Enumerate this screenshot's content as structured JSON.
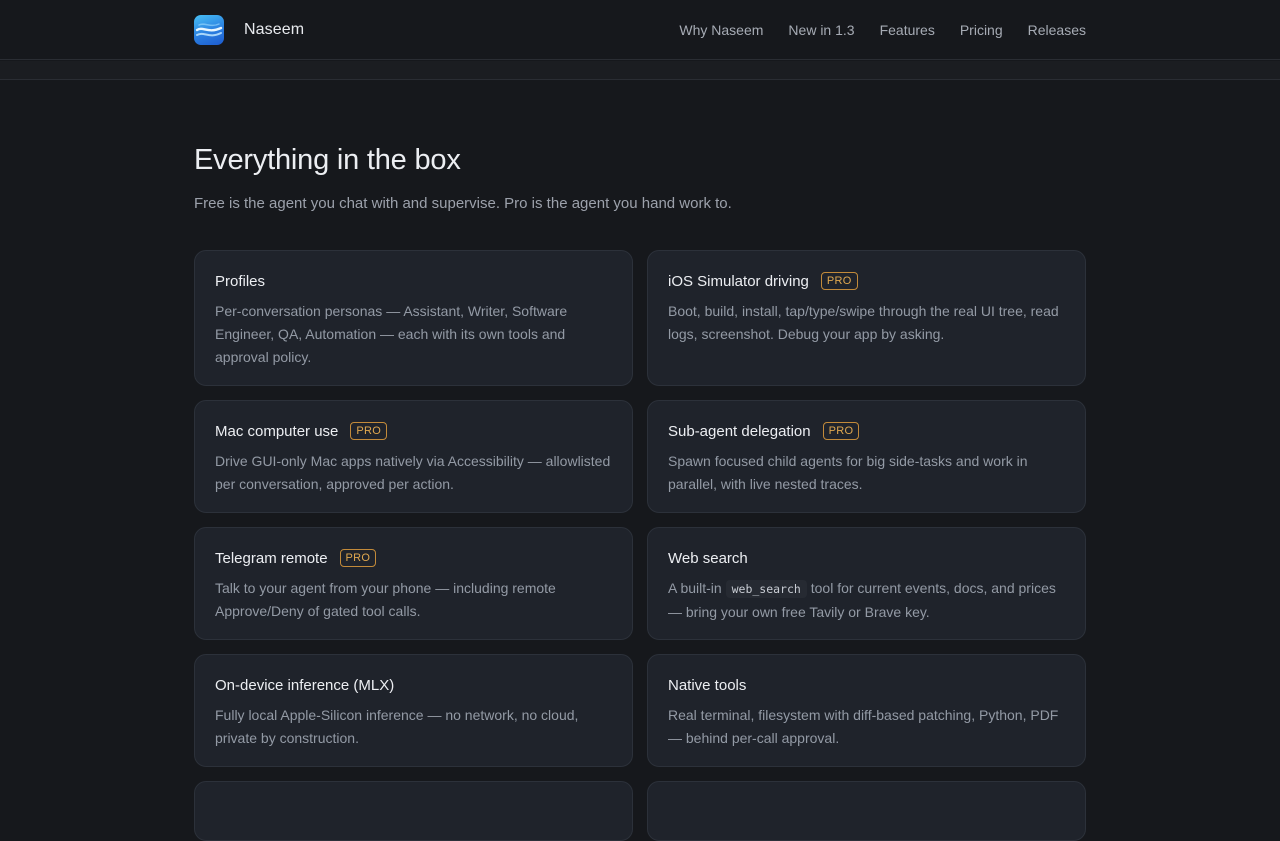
{
  "nav": {
    "brand": "Naseem",
    "links": [
      "Why Naseem",
      "New in 1.3",
      "Features",
      "Pricing",
      "Releases"
    ]
  },
  "hero": {
    "title": "Everything in the box",
    "subtitle": "Free is the agent you chat with and supervise. Pro is the agent you hand work to."
  },
  "badge_label": "PRO",
  "cards": [
    {
      "title": "Profiles",
      "pro": false,
      "desc": "Per-conversation personas — Assistant, Writer, Software Engineer, QA, Automation — each with its own tools and approval policy."
    },
    {
      "title": "iOS Simulator driving",
      "pro": true,
      "desc": "Boot, build, install, tap/type/swipe through the real UI tree, read logs, screenshot. Debug your app by asking."
    },
    {
      "title": "Mac computer use",
      "pro": true,
      "desc": "Drive GUI-only Mac apps natively via Accessibility — allowlisted per conversation, approved per action."
    },
    {
      "title": "Sub-agent delegation",
      "pro": true,
      "desc": "Spawn focused child agents for big side-tasks and work in parallel, with live nested traces."
    },
    {
      "title": "Telegram remote",
      "pro": true,
      "desc": "Talk to your agent from your phone — including remote Approve/Deny of gated tool calls."
    },
    {
      "title": "Web search",
      "pro": false,
      "desc_before": "A built-in ",
      "desc_code": "web_search",
      "desc_after": " tool for current events, docs, and prices — bring your own free Tavily or Brave key."
    },
    {
      "title": "On-device inference (MLX)",
      "pro": false,
      "desc": "Fully local Apple-Silicon inference — no network, no cloud, private by construction."
    },
    {
      "title": "Native tools",
      "pro": false,
      "desc": "Real terminal, filesystem with diff-based patching, Python, PDF — behind per-call approval."
    }
  ]
}
